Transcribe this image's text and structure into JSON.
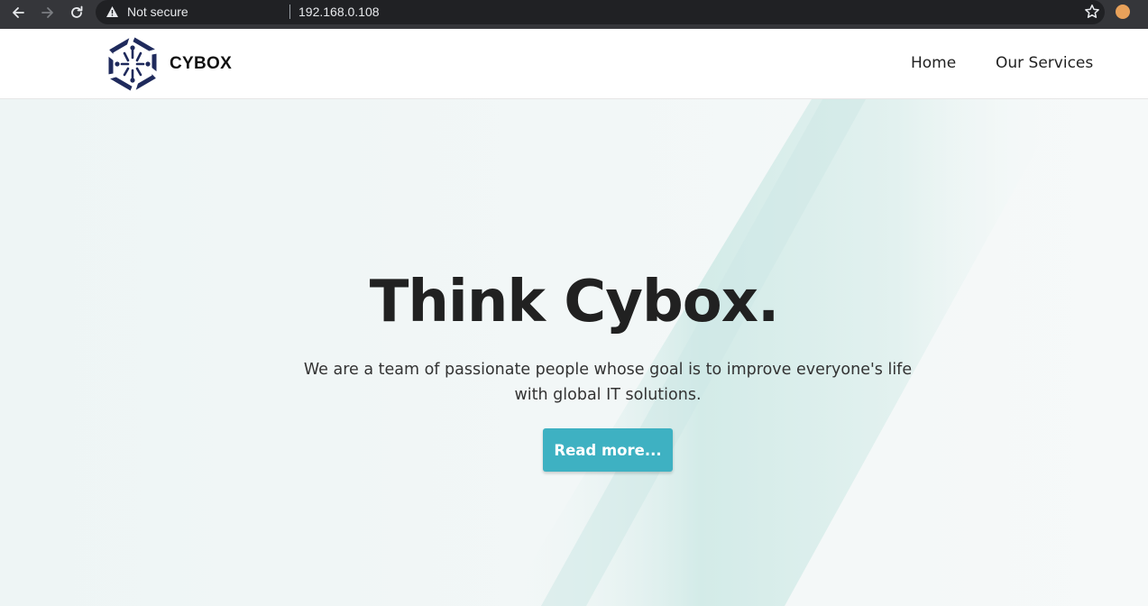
{
  "browser": {
    "security_label": "Not secure",
    "url": "192.168.0.108",
    "icons": {
      "back": "arrow-left-icon",
      "forward": "arrow-right-icon",
      "reload": "reload-icon",
      "warning": "warning-triangle-icon",
      "bookmark": "star-icon",
      "profile": "profile-avatar-icon"
    }
  },
  "header": {
    "brand": "CYBOX",
    "nav": {
      "home": "Home",
      "services": "Our Services"
    }
  },
  "hero": {
    "title": "Think Cybox.",
    "description": "We are a team of passionate people whose goal is to improve everyone's life with global IT solutions.",
    "button_label": "Read more..."
  },
  "colors": {
    "browser_chrome": "#35363a",
    "omnibox": "#202124",
    "logo_navy": "#1f2a5c",
    "accent_teal": "#3eb1c2",
    "hero_background": "#f3f7f7",
    "hero_band": "#cfe9e6",
    "heading_text": "#212121"
  }
}
